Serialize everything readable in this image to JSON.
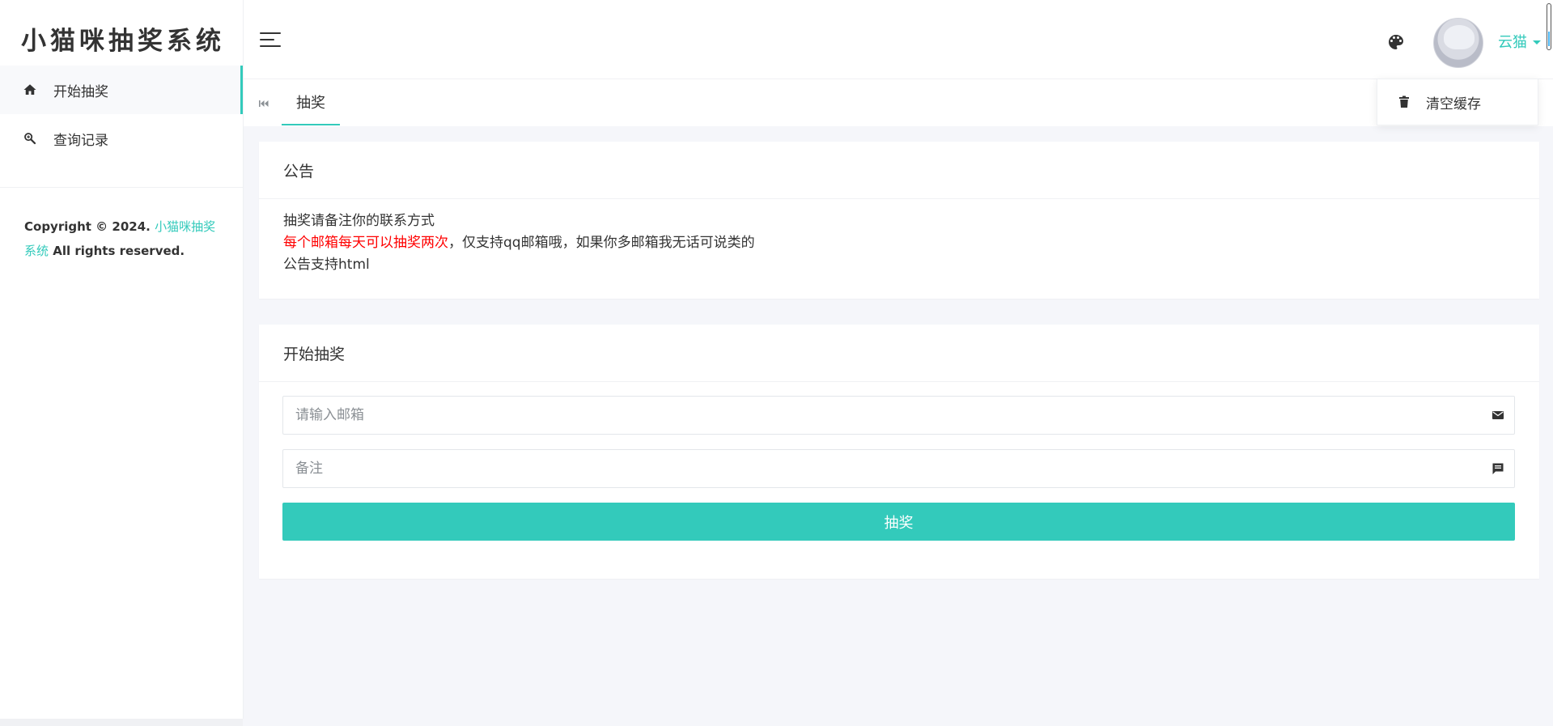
{
  "app": {
    "logo_text": "小猫咪抽奖系统",
    "accent_color": "#33cabb"
  },
  "sidebar": {
    "items": [
      {
        "label": "开始抽奖",
        "icon": "home-icon",
        "active": true
      },
      {
        "label": "查询记录",
        "icon": "search-record-icon",
        "active": false
      }
    ],
    "copyright": {
      "prefix": "Copyright © 2024. ",
      "brand": "小猫咪抽奖系统",
      "suffix": " All rights reserved."
    }
  },
  "header": {
    "user_name": "云猫",
    "dropdown": {
      "items": [
        {
          "label": "清空缓存",
          "icon": "trash-icon"
        }
      ]
    }
  },
  "tabs": [
    {
      "label": "抽奖",
      "active": true
    }
  ],
  "notice": {
    "title": "公告",
    "line1": "抽奖请备注你的联系方式",
    "line2_red": "每个邮箱每天可以抽奖两次",
    "line2_rest": "，仅支持qq邮箱哦，如果你多邮箱我无话可说类的",
    "line3": "公告支持html"
  },
  "draw": {
    "title": "开始抽奖",
    "email_placeholder": "请输入邮箱",
    "email_value": "",
    "note_placeholder": "备注",
    "note_value": "",
    "submit_label": "抽奖"
  }
}
